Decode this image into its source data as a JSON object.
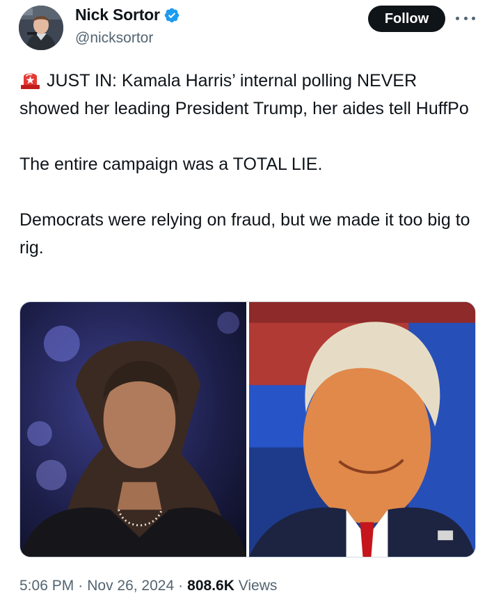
{
  "author": {
    "display_name": "Nick Sortor",
    "handle": "@nicksortor",
    "verified": true
  },
  "actions": {
    "follow_label": "Follow",
    "more_icon": "more-horizontal-icon"
  },
  "tweet": {
    "lines": [
      "JUST IN: Kamala Harris’ internal polling NEVER showed her leading President Trump, her aides tell HuffPo",
      "The entire campaign was a TOTAL LIE.",
      "Democrats were relying on fraud, but we made it too big to rig."
    ],
    "leading_emoji": "police-car-light-icon"
  },
  "media": {
    "photos": [
      {
        "name": "photo-harris"
      },
      {
        "name": "photo-trump"
      }
    ]
  },
  "meta": {
    "time": "5:06 PM",
    "date": "Nov 26, 2024",
    "views_count": "808.6K",
    "views_label": "Views",
    "separator": "·"
  },
  "colors": {
    "text": "#0f1419",
    "secondary": "#536471",
    "verified": "#1d9bf0",
    "follow_bg": "#0f1419"
  }
}
